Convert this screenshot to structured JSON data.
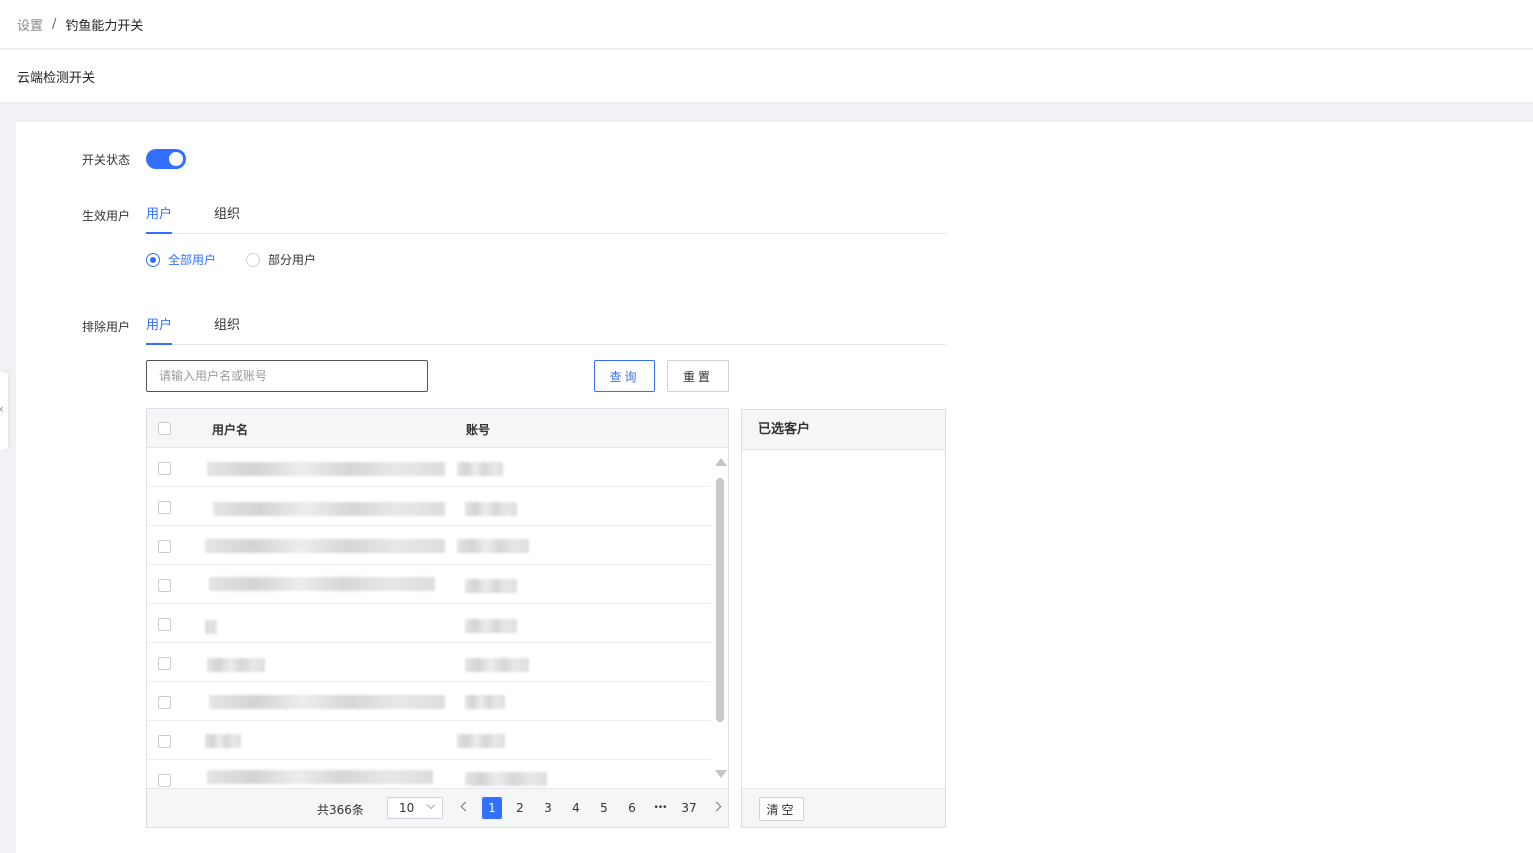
{
  "breadcrumb": {
    "parent": "设置",
    "separator": "/",
    "current": "钓鱼能力开关"
  },
  "section_title": "云端检测开关",
  "switch": {
    "label": "开关状态",
    "on": true
  },
  "effective_users": {
    "label": "生效用户",
    "tabs": [
      {
        "label": "用户",
        "active": true
      },
      {
        "label": "组织",
        "active": false
      }
    ],
    "radios": [
      {
        "label": "全部用户",
        "checked": true
      },
      {
        "label": "部分用户",
        "checked": false
      }
    ]
  },
  "excluded_users": {
    "label": "排除用户",
    "tabs": [
      {
        "label": "用户",
        "active": true
      },
      {
        "label": "组织",
        "active": false
      }
    ],
    "search": {
      "placeholder": "请输入用户名或账号",
      "value": ""
    },
    "query_label": "查询",
    "reset_label": "重置",
    "table": {
      "columns": [
        "用户名",
        "账号"
      ]
    },
    "pagination": {
      "total_text": "共366条",
      "page_size": "10",
      "pages": [
        "1",
        "2",
        "3",
        "4",
        "5",
        "6",
        "•••",
        "37"
      ],
      "current_page": "1"
    },
    "selected": {
      "title": "已选客户",
      "clear_label": "清空"
    }
  }
}
